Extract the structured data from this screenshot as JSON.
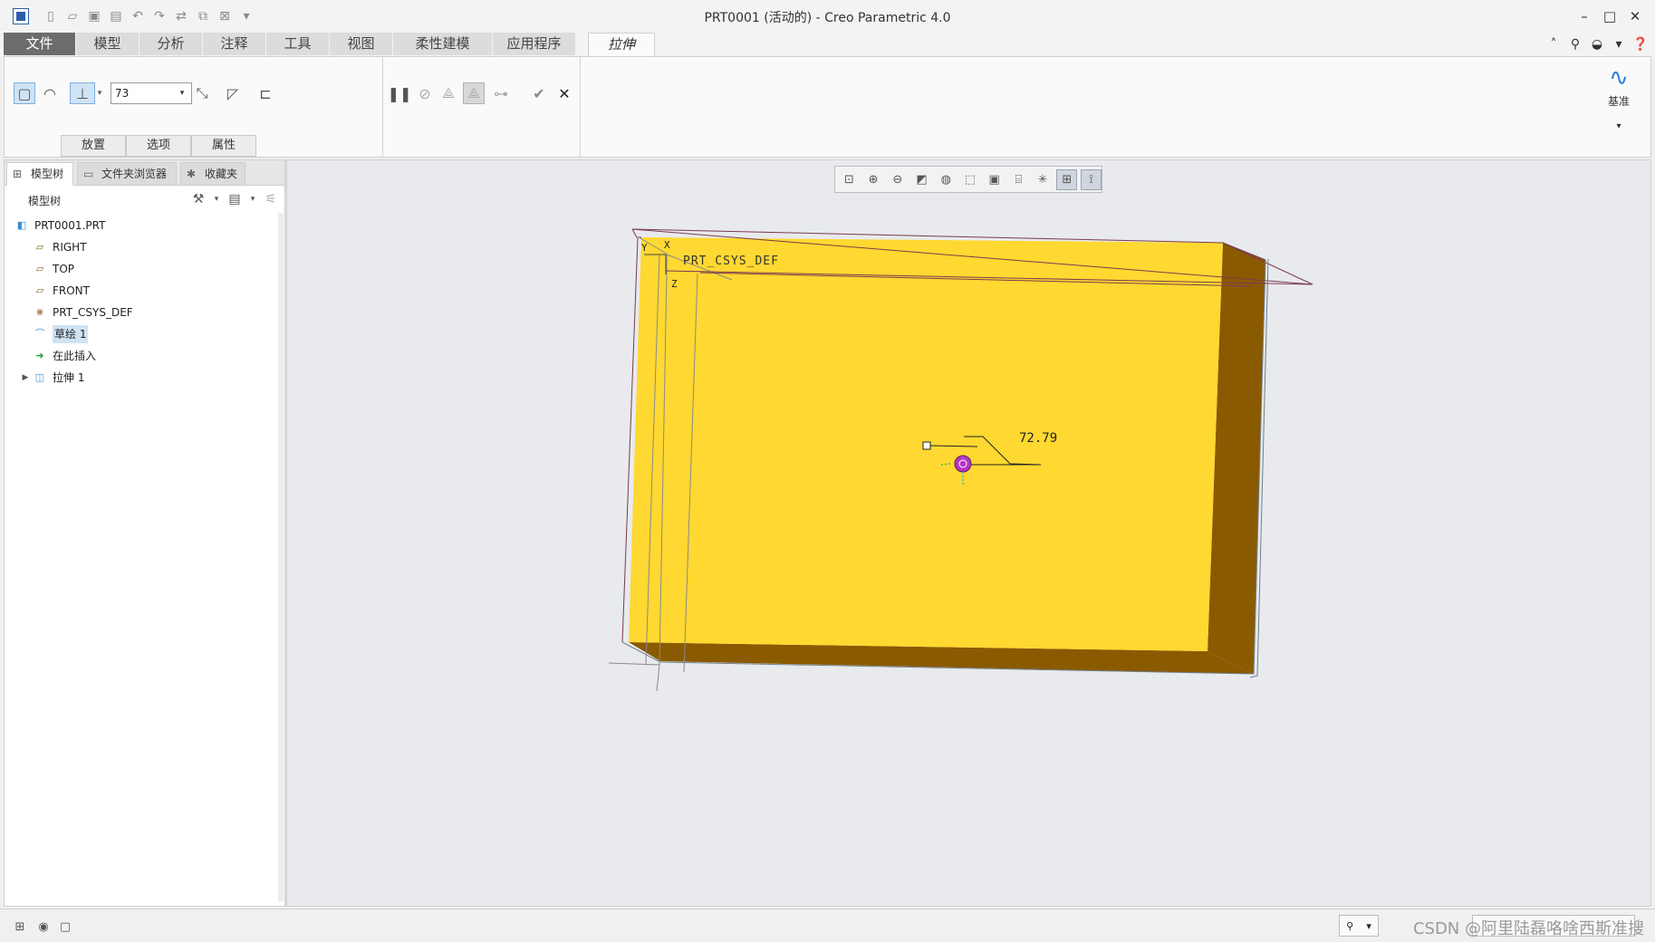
{
  "window": {
    "title": "PRT0001 (活动的) - Creo Parametric 4.0",
    "controls": [
      "minimize",
      "maximize",
      "close"
    ]
  },
  "quick_access": [
    "new-icon",
    "open-icon",
    "open-recent-icon",
    "save-icon",
    "undo-icon",
    "redo-icon",
    "regenerate-icon",
    "window-icon",
    "close-window-icon",
    "customize-icon"
  ],
  "ribbon_tabs": [
    {
      "label": "文件"
    },
    {
      "label": "模型"
    },
    {
      "label": "分析"
    },
    {
      "label": "注释"
    },
    {
      "label": "工具"
    },
    {
      "label": "视图"
    },
    {
      "label": "柔性建模"
    },
    {
      "label": "应用程序"
    },
    {
      "label": "拉伸"
    }
  ],
  "ribbon": {
    "depth_value": "73",
    "subtabs": [
      "放置",
      "选项",
      "属性"
    ],
    "datum_label": "基准"
  },
  "panel_tabs": [
    "模型树",
    "文件夹浏览器",
    "收藏夹"
  ],
  "model_tree": {
    "header": "模型树",
    "nodes": [
      {
        "label": "PRT0001.PRT",
        "icon": "part-icon"
      },
      {
        "label": "RIGHT",
        "icon": "datum-plane-icon"
      },
      {
        "label": "TOP",
        "icon": "datum-plane-icon"
      },
      {
        "label": "FRONT",
        "icon": "datum-plane-icon"
      },
      {
        "label": "PRT_CSYS_DEF",
        "icon": "csys-icon"
      },
      {
        "label": "草绘 1",
        "icon": "sketch-icon"
      },
      {
        "label": "在此插入",
        "icon": "insert-arrow-icon"
      },
      {
        "label": "拉伸 1",
        "icon": "extrude-icon"
      }
    ]
  },
  "scene": {
    "csys_label": "PRT_CSYS_DEF",
    "axis_x": "X",
    "axis_y": "Y",
    "axis_z": "Z",
    "dimension": "72.79",
    "colors": {
      "face": "#ffd831",
      "side": "#8a5a00",
      "edge": "#7a3b4f"
    }
  },
  "status": {
    "watermark": "CSDN @阿里陆磊咯啥西斯准搜"
  }
}
